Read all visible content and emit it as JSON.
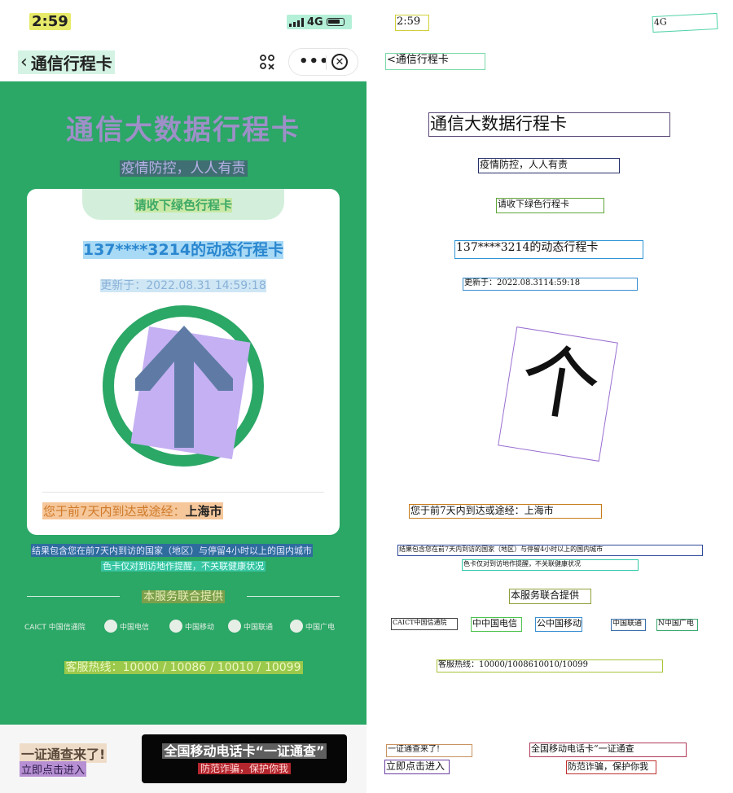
{
  "status_bar": {
    "time": "2:59",
    "network": "4G"
  },
  "nav": {
    "title": "通信行程卡",
    "back_chevron": "‹"
  },
  "hero": {
    "title": "通信大数据行程卡",
    "slogan": "疫情防控，人人有责"
  },
  "card": {
    "tab": "请收下绿色行程卡",
    "phone_line": "137****3214的动态行程卡",
    "update_prefix": "更新于：",
    "update_time": "2022.08.31 14:59:18",
    "route_prefix": "您于前7天内到达或途经：",
    "route_city": "上海市",
    "status_color": "#2ba766"
  },
  "notes": {
    "line1": "结果包含您在前7天内到访的国家（地区）与停留4小时以上的国内城市",
    "line2": "色卡仅对到访地作提醒，不关联健康状况"
  },
  "provider": {
    "title": "本服务联合提供",
    "logos": [
      "CAICT 中国信通院",
      "中国电信",
      "中国移动",
      "中国联通",
      "中国广电"
    ]
  },
  "hotline": "客服热线：10000 / 10086 / 10010 / 10099",
  "promo": {
    "title": "一证通查来了!",
    "link": "立即点击进入",
    "ad_title": "全国移动电话卡“一证通查”",
    "ad_sub": "防范诈骗，保护你我"
  },
  "overlay": {
    "time": "2:59",
    "net": "4G",
    "nav": "<通信行程卡",
    "title": "通信大数据行程卡",
    "slogan": "疫情防控，人人有责",
    "tab": "请收下绿色行程卡",
    "phone": "137****3214的动态行程卡",
    "update": "更新于：2022.08.3114:59:18",
    "arrow_glyph": "个",
    "route": "您于前7天内到达或途经：上海市",
    "note1": "结果包含您在前7天内到访的国家（地区）与停留4小时以上的国内城市",
    "note2": "色卡仅对到访地作提醒，不关联健康状况",
    "provided": "本服务联合提供",
    "logo1": "CAICT中国信通院",
    "logo2": "中中国电信",
    "logo3": "公中国移动",
    "logo4": "中国联通",
    "logo5": "N中国广电",
    "hotline": "客服热线：10000/1008610010/10099",
    "promo_title": "一证通查来了!",
    "promo_link": "立即点击进入",
    "ad_title": "全国移动电话卡“一证通查",
    "ad_sub": "防范诈骗，保护你我"
  },
  "colors": {
    "green": "#2ba766",
    "arrow": "#5f7ba5",
    "ad_bg": "#060606",
    "accent_red": "#b3262d"
  }
}
